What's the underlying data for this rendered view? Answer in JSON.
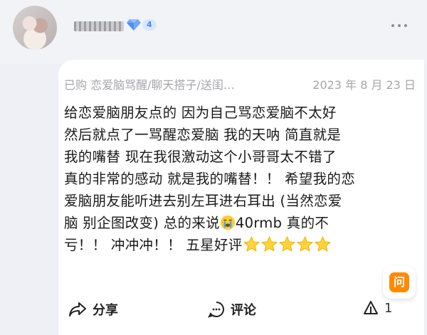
{
  "user": {
    "username": "",
    "level": "4"
  },
  "review": {
    "meta": "已购 恋爱脑骂醒/聊天搭子/送闺…",
    "date": "2023 年 8 月 23 日",
    "lines": [
      "给恋爱脑朋友点的  因为自己骂恋爱脑不太好",
      "然后就点了一骂醒恋爱脑 我的天呐 简直就是",
      "我的嘴替 现在我很激动这个小哥哥太不错了",
      "真的非常的感动 就是我的嘴替！！ 希望我的恋",
      "爱脑朋友能听进去别左耳进右耳出 (当然恋爱",
      "脑 别企图改变) 总的来说",
      "40rmb 真的不",
      "亏！！ 冲冲冲！！ 五星好评"
    ],
    "stars": 5
  },
  "actions": {
    "share_label": "分享",
    "comment_label": "评论",
    "like_count": "1"
  },
  "ask": {
    "label": "问"
  },
  "colors": {
    "accent_orange": "#ff8a00",
    "level_blue": "#4a86ff",
    "star_yellow": "#ffd43b"
  }
}
